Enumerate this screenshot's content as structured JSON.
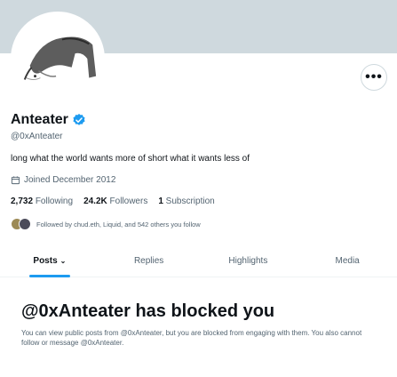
{
  "profile": {
    "display_name": "Anteater",
    "handle": "@0xAnteater",
    "bio": "long what the world wants more of short what it wants less of",
    "joined": "Joined December 2012",
    "verified": true
  },
  "stats": {
    "following_count": "2,732",
    "following_label": "Following",
    "followers_count": "24.2K",
    "followers_label": "Followers",
    "subscriptions_count": "1",
    "subscriptions_label": "Subscription"
  },
  "followed_by": "Followed by chud.eth, Liquid, and 542 others you follow",
  "more_button": "•••",
  "tabs": [
    {
      "label": "Posts",
      "active": true
    },
    {
      "label": "Replies",
      "active": false
    },
    {
      "label": "Highlights",
      "active": false
    },
    {
      "label": "Media",
      "active": false
    }
  ],
  "blocked": {
    "title": "@0xAnteater has blocked you",
    "body": "You can view public posts from @0xAnteater, but you are blocked from engaging with them. You also cannot follow or message @0xAnteater."
  },
  "colors": {
    "banner": "#cfd9de",
    "accent": "#1d9bf0",
    "text": "#0f1419",
    "muted": "#536471"
  }
}
